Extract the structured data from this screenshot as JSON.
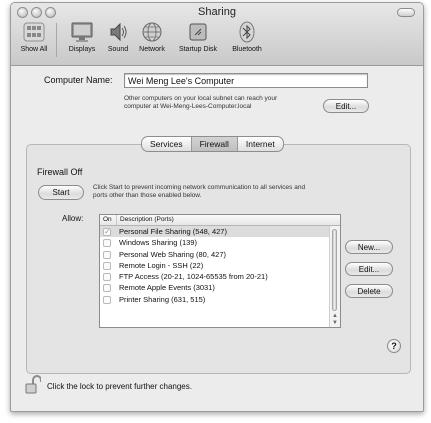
{
  "window": {
    "title": "Sharing"
  },
  "toolbar": {
    "items": [
      {
        "label": "Show All"
      },
      {
        "label": "Displays"
      },
      {
        "label": "Sound"
      },
      {
        "label": "Network"
      },
      {
        "label": "Startup Disk"
      },
      {
        "label": "Bluetooth"
      }
    ]
  },
  "computer": {
    "name_label": "Computer Name:",
    "name_value": "Wei Meng Lee's Computer",
    "info_line1": "Other computers on your local subnet can reach your",
    "info_line2": "computer at Wei-Meng-Lees-Computer.local",
    "edit_label": "Edit..."
  },
  "tabs": [
    {
      "label": "Services",
      "selected": false
    },
    {
      "label": "Firewall",
      "selected": true
    },
    {
      "label": "Internet",
      "selected": false
    }
  ],
  "firewall": {
    "status": "Firewall Off",
    "start_label": "Start",
    "desc_line1": "Click Start to prevent incoming network communication to all services and",
    "desc_line2": "ports other than those enabled below.",
    "allow_label": "Allow:",
    "list_header_on": "On",
    "list_header_desc": "Description (Ports)",
    "rows": [
      {
        "label": "Personal File Sharing (548, 427)",
        "checked": true,
        "selected": true
      },
      {
        "label": "Windows Sharing (139)",
        "checked": false,
        "selected": false
      },
      {
        "label": "Personal Web Sharing (80, 427)",
        "checked": false,
        "selected": false
      },
      {
        "label": "Remote Login - SSH (22)",
        "checked": false,
        "selected": false
      },
      {
        "label": "FTP Access (20-21, 1024-65535 from 20-21)",
        "checked": false,
        "selected": false
      },
      {
        "label": "Remote Apple Events (3031)",
        "checked": false,
        "selected": false
      },
      {
        "label": "Printer Sharing (631, 515)",
        "checked": false,
        "selected": false
      }
    ],
    "new_label": "New...",
    "edit_label": "Edit...",
    "delete_label": "Delete"
  },
  "help_label": "?",
  "lock_text": "Click the lock to prevent further changes."
}
